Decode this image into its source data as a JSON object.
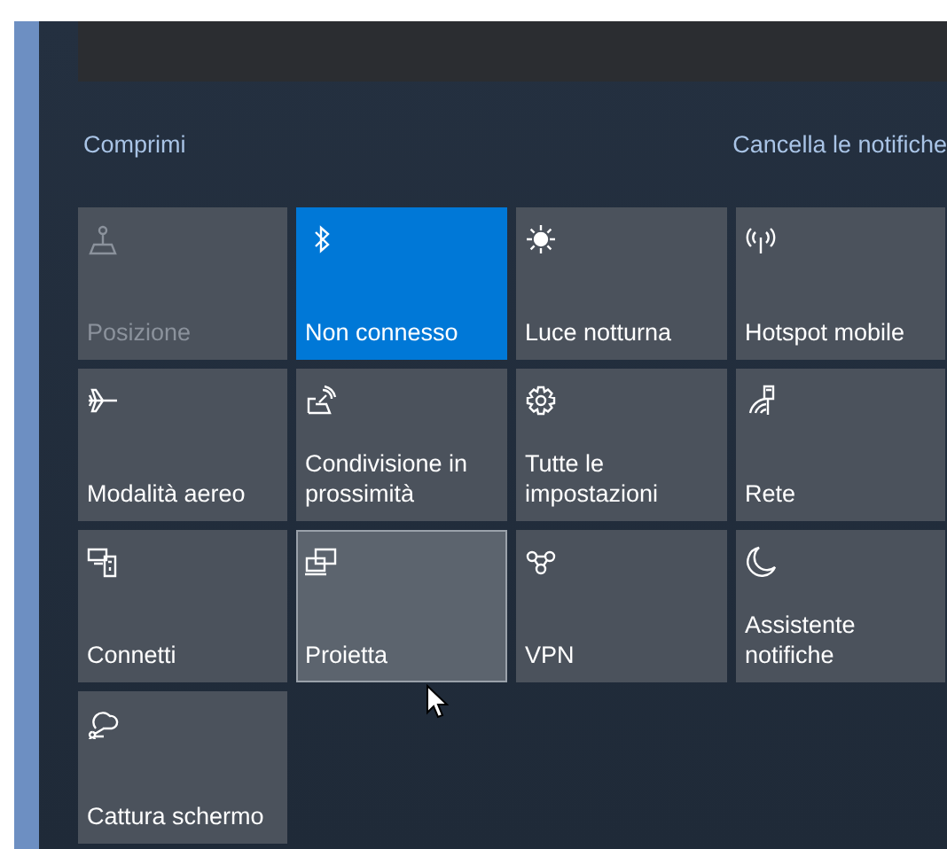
{
  "header": {
    "collapse_link": "Comprimi",
    "clear_link": "Cancella le notifiche"
  },
  "tiles": [
    {
      "kind": "location",
      "label": "Posizione",
      "on": false,
      "disabled": true,
      "hovered": false
    },
    {
      "kind": "bluetooth",
      "label": "Non connesso",
      "on": true,
      "disabled": false,
      "hovered": false
    },
    {
      "kind": "brightness",
      "label": "Luce notturna",
      "on": false,
      "disabled": false,
      "hovered": false
    },
    {
      "kind": "hotspot",
      "label": "Hotspot mobile",
      "on": false,
      "disabled": false,
      "hovered": false
    },
    {
      "kind": "airplane",
      "label": "Modalità aereo",
      "on": false,
      "disabled": false,
      "hovered": false
    },
    {
      "kind": "share",
      "label": "Condivisione in prossimità",
      "on": false,
      "disabled": false,
      "hovered": false
    },
    {
      "kind": "settings",
      "label": "Tutte le impostazioni",
      "on": false,
      "disabled": false,
      "hovered": false
    },
    {
      "kind": "network",
      "label": "Rete",
      "on": false,
      "disabled": false,
      "hovered": false
    },
    {
      "kind": "connect",
      "label": "Connetti",
      "on": false,
      "disabled": false,
      "hovered": false
    },
    {
      "kind": "project",
      "label": "Proietta",
      "on": false,
      "disabled": false,
      "hovered": true
    },
    {
      "kind": "vpn",
      "label": "VPN",
      "on": false,
      "disabled": false,
      "hovered": false
    },
    {
      "kind": "moon",
      "label": "Assistente notifiche",
      "on": false,
      "disabled": false,
      "hovered": false
    },
    {
      "kind": "snip",
      "label": "Cattura schermo",
      "on": false,
      "disabled": false,
      "hovered": false
    }
  ]
}
